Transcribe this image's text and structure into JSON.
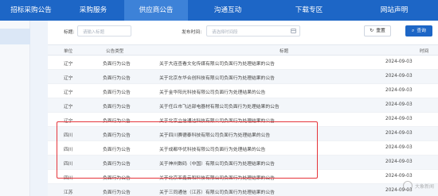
{
  "nav": {
    "items": [
      {
        "label": "招标采购公告",
        "active": false
      },
      {
        "label": "采购服务",
        "active": false
      },
      {
        "label": "供应商公告",
        "active": true
      },
      {
        "label": "沟通互动",
        "active": false
      },
      {
        "label": "下载专区",
        "active": false
      },
      {
        "label": "网站声明",
        "active": false
      }
    ]
  },
  "filter": {
    "title_label": "标题:",
    "title_placeholder": "请输入标题",
    "time_label": "发布时间:",
    "time_placeholder": "请选择时间段",
    "reset_label": "重置",
    "query_label": "查询",
    "reset_icon": "refresh-icon",
    "query_icon": "search-icon"
  },
  "table": {
    "headers": {
      "province": "单位",
      "type": "公告类型",
      "title": "标题",
      "time": "时间"
    },
    "rows": [
      {
        "province": "辽宁",
        "type": "负面行为公告",
        "title": "关于大连查看文化传媒有限公司负面行为处理结果的公告",
        "time": "2024-09-03"
      },
      {
        "province": "辽宁",
        "type": "负面行为公告",
        "title": "关于北京东华合创科技有限公司负面行为处理结果的公告",
        "time": "2024-09-03"
      },
      {
        "province": "辽宁",
        "type": "负面行为公告",
        "title": "关于金华阳光科技有限公司负面行为处理结果的公告",
        "time": "2024-09-03"
      },
      {
        "province": "辽宁",
        "type": "负面行为公告",
        "title": "关于任丘市飞达部电器材有限公司负面行为处理结果的公告",
        "time": "2024-09-03"
      },
      {
        "province": "辽宁",
        "type": "负面行为公告",
        "title": "关于北京立信通达科技有限公司负面行为处理结果的公告",
        "time": "2024-09-03"
      },
      {
        "province": "四川",
        "type": "负面行为公告",
        "title": "关于四川赛德泰科技有限公司负面行为处理结果的公告",
        "time": "2024-09-03"
      },
      {
        "province": "四川",
        "type": "负面行为公告",
        "title": "关于成都华优科技有限公司负面行为处理结果的公告",
        "time": "2024-09-03"
      },
      {
        "province": "四川",
        "type": "负面行为公告",
        "title": "关于神州数码（中国）有限公司负面行为处理结果的公告",
        "time": "2024-09-03"
      },
      {
        "province": "四川",
        "type": "负面行为公告",
        "title": "关于北京亚鑫云和科技有限公司负面行为处理结果的公告",
        "time": "2024-09-03"
      },
      {
        "province": "江苏",
        "type": "负面行为公告",
        "title": "关于三同通信（江苏）有限公司负面行为处理结果的公告",
        "time": "2024-09-03"
      }
    ]
  },
  "watermark": {
    "text": "大象新闻"
  },
  "colors": {
    "nav_bg": "#1d66c6",
    "nav_active": "#3d82d8",
    "highlight": "#e5343a"
  }
}
